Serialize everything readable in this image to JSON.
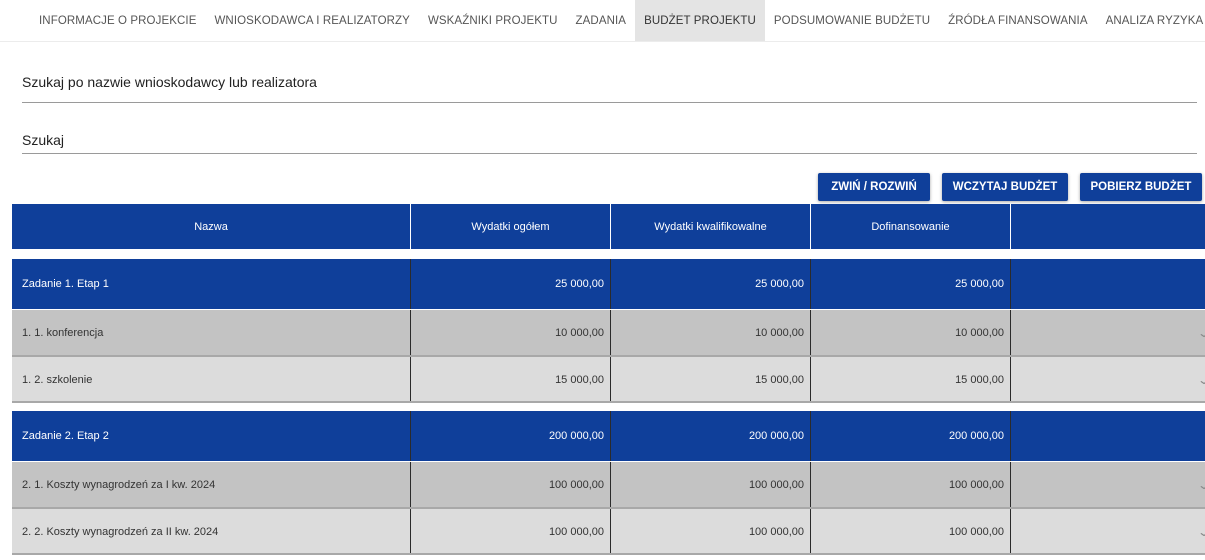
{
  "tabs": [
    {
      "label": "INFORMACJE O PROJEKCIE",
      "active": false
    },
    {
      "label": "WNIOSKODAWCA I REALIZATORZY",
      "active": false
    },
    {
      "label": "WSKAŹNIKI PROJEKTU",
      "active": false
    },
    {
      "label": "ZADANIA",
      "active": false
    },
    {
      "label": "BUDŻET PROJEKTU",
      "active": true
    },
    {
      "label": "PODSUMOWANIE BUDŻETU",
      "active": false
    },
    {
      "label": "ŹRÓDŁA FINANSOWANIA",
      "active": false
    },
    {
      "label": "ANALIZA RYZYKA",
      "active": false
    }
  ],
  "tabs_more": ">",
  "search": {
    "applicant_label": "Szukaj po nazwie wnioskodawcy lub realizatora",
    "search_label": "Szukaj"
  },
  "buttons": {
    "toggle": "ZWIŃ / ROZWIŃ",
    "load": "WCZYTAJ BUDŻET",
    "download": "POBIERZ BUDŻET"
  },
  "table": {
    "headers": [
      "Nazwa",
      "Wydatki ogółem",
      "Wydatki kwalifikowalne",
      "Dofinansowanie",
      ""
    ],
    "rows": [
      {
        "kind": "task",
        "name": "Zadanie 1. Etap 1",
        "total": "25 000,00",
        "eligible": "25 000,00",
        "funding": "25 000,00"
      },
      {
        "kind": "sub-dark",
        "name": "1. 1. konferencja",
        "total": "10 000,00",
        "eligible": "10 000,00",
        "funding": "10 000,00"
      },
      {
        "kind": "sub-light",
        "name": "1. 2. szkolenie",
        "total": "15 000,00",
        "eligible": "15 000,00",
        "funding": "15 000,00"
      },
      {
        "kind": "task",
        "name": "Zadanie 2. Etap 2",
        "total": "200 000,00",
        "eligible": "200 000,00",
        "funding": "200 000,00"
      },
      {
        "kind": "sub-dark",
        "name": "2. 1. Koszty wynagrodzeń za I kw. 2024",
        "total": "100 000,00",
        "eligible": "100 000,00",
        "funding": "100 000,00"
      },
      {
        "kind": "sub-light",
        "name": "2. 2. Koszty wynagrodzeń za II kw. 2024",
        "total": "100 000,00",
        "eligible": "100 000,00",
        "funding": "100 000,00"
      }
    ]
  },
  "icons": {
    "row_expand": "chevron-down-icon"
  },
  "colors": {
    "primary": "#0f3f9a",
    "sub_dark": "#c3c3c3",
    "sub_light": "#dcdcdc"
  }
}
